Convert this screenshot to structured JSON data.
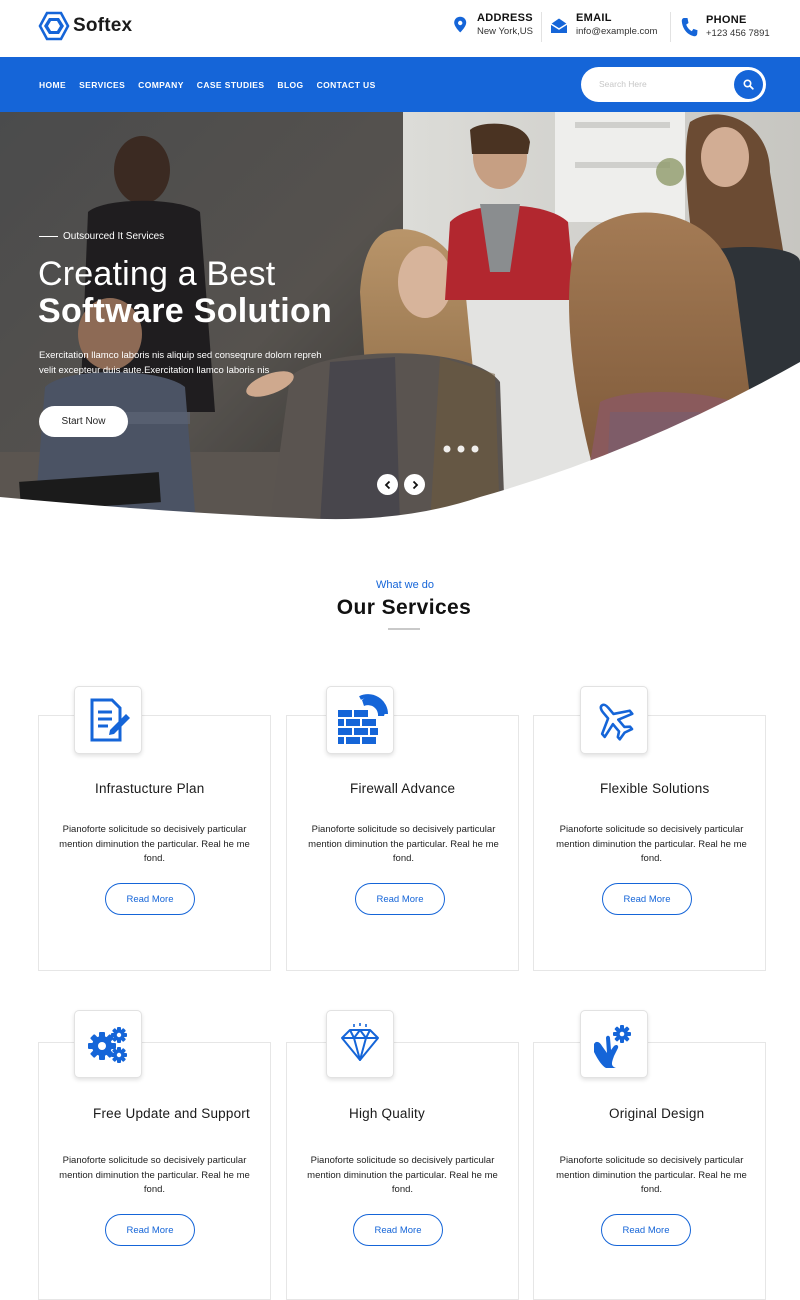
{
  "header": {
    "brand": "Softex",
    "address": {
      "title": "ADDRESS",
      "value": "New York,US"
    },
    "email": {
      "title": "EMAIL",
      "value": "info@example.com"
    },
    "phone": {
      "title": "PHONE",
      "value": "+123 456 7891"
    }
  },
  "nav": {
    "items": [
      "HOME",
      "SERVICES",
      "COMPANY",
      "CASE STUDIES",
      "BLOG",
      "CONTACT US"
    ],
    "search_placeholder": "Search Here"
  },
  "hero": {
    "tag": "Outsourced It Services",
    "title_line1": "Creating a Best",
    "title_line2": "Software Solution",
    "description": "Exercitation llamco laboris nis aliquip sed conseqrure dolorn repreh velit excepteur duis aute.Exercitation llamco laboris nis",
    "cta": "Start Now"
  },
  "services": {
    "subtitle": "What we do",
    "title": "Our Services",
    "items": [
      {
        "title": "Infrastucture Plan",
        "icon": "document-edit-icon",
        "description": "Pianoforte solicitude so decisively particular mention diminution the particular. Real he me   fond.",
        "button": "Read More"
      },
      {
        "title": "Firewall Advance",
        "icon": "firewall-icon",
        "description": "Pianoforte solicitude so decisively particular mention diminution the particular. Real he me   fond.",
        "button": "Read More"
      },
      {
        "title": "Flexible Solutions",
        "icon": "airplane-icon",
        "description": "Pianoforte solicitude so decisively particular mention diminution the particular. Real he me   fond.",
        "button": "Read More"
      },
      {
        "title": "Free Update and Support",
        "icon": "gears-icon",
        "description": "Pianoforte solicitude so decisively particular mention diminution the particular. Real he me   fond.",
        "button": "Read More"
      },
      {
        "title": "High Quality",
        "icon": "diamond-icon",
        "description": "Pianoforte solicitude so decisively particular mention diminution the particular. Real he me   fond.",
        "button": "Read More"
      },
      {
        "title": "Original Design",
        "icon": "hand-gear-icon",
        "description": "Pianoforte solicitude so decisively particular mention diminution the particular. Real he me   fond.",
        "button": "Read More"
      }
    ]
  },
  "colors": {
    "primary": "#1565d8",
    "text": "#222222",
    "border": "#e6e6e6"
  }
}
